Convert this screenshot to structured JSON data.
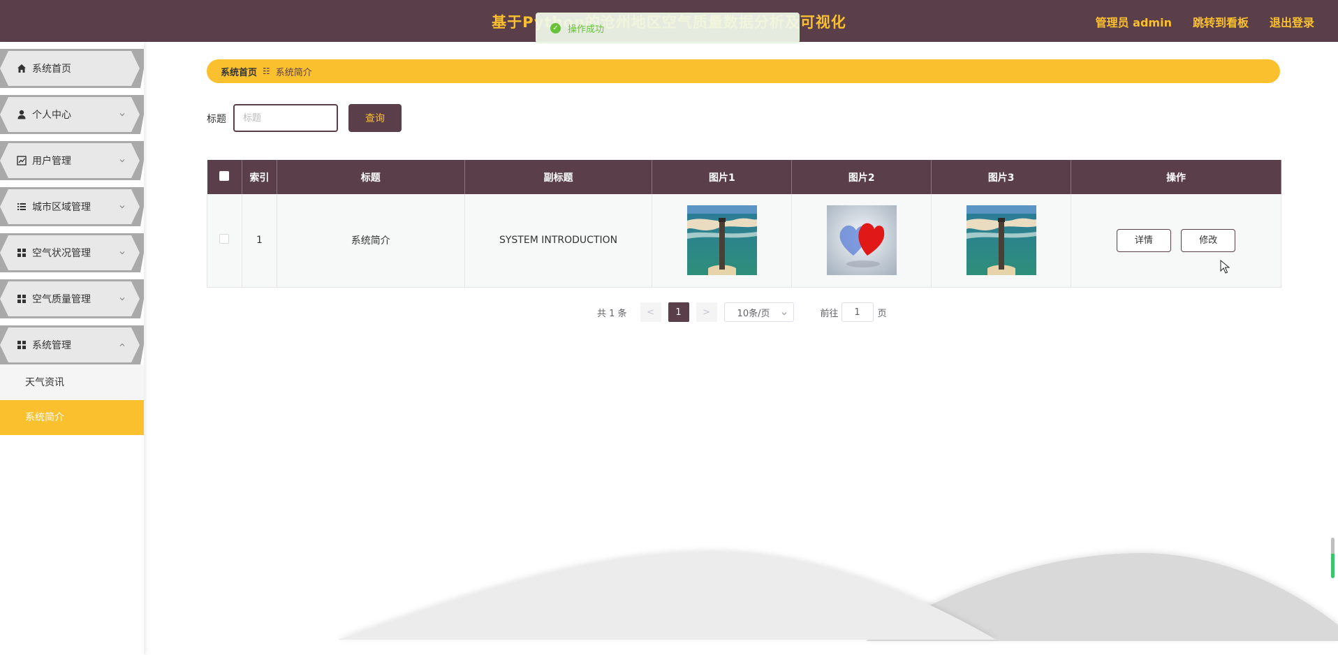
{
  "header": {
    "title": "基于Python的沧州地区空气质量数据分析及可视化",
    "admin_label": "管理员 admin",
    "dashboard_link": "跳转到看板",
    "logout_link": "退出登录"
  },
  "toast": {
    "message": "操作成功",
    "icon": "success-check-icon",
    "color": "#67c23a"
  },
  "sidebar": {
    "items": [
      {
        "label": "系统首页",
        "icon": "home-icon"
      },
      {
        "label": "个人中心",
        "icon": "user-icon"
      },
      {
        "label": "用户管理",
        "icon": "chart-icon"
      },
      {
        "label": "城市区域管理",
        "icon": "list-icon"
      },
      {
        "label": "空气状况管理",
        "icon": "grid-icon"
      },
      {
        "label": "空气质量管理",
        "icon": "grid-icon"
      },
      {
        "label": "系统管理",
        "icon": "grid-icon"
      }
    ],
    "subitems": [
      {
        "label": "天气资讯",
        "active": false
      },
      {
        "label": "系统简介",
        "active": true
      }
    ]
  },
  "breadcrumb": {
    "home": "系统首页",
    "separator": "☷",
    "current": "系统简介"
  },
  "search": {
    "label": "标题",
    "placeholder": "标题",
    "button": "查询"
  },
  "table": {
    "columns": [
      "索引",
      "标题",
      "副标题",
      "图片1",
      "图片2",
      "图片3",
      "操作"
    ],
    "rows": [
      {
        "index": "1",
        "title": "系统简介",
        "subtitle": "SYSTEM INTRODUCTION",
        "images": [
          "lighthouse-image",
          "hearts-image",
          "lighthouse-image"
        ],
        "actions": {
          "detail": "详情",
          "edit": "修改"
        }
      }
    ]
  },
  "pagination": {
    "total_text": "共 1 条",
    "prev": "<",
    "current_page": "1",
    "next": ">",
    "page_size": "10条/页",
    "goto_label": "前往",
    "goto_value": "1",
    "goto_suffix": "页"
  },
  "colors": {
    "primary": "#5a3f4a",
    "accent": "#fbc02d"
  }
}
